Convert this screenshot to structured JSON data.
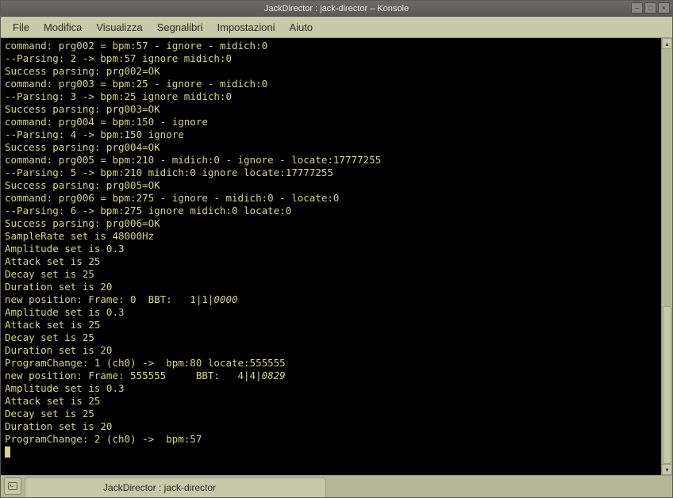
{
  "window": {
    "title": "JackDirector : jack-director – Konsole"
  },
  "menu": {
    "file": "File",
    "edit": "Modifica",
    "view": "Visualizza",
    "bookmarks": "Segnalibri",
    "settings": "Impostazioni",
    "help": "Aiuto"
  },
  "terminal": {
    "lines": [
      {
        "t": "command: prg002 = bpm:57 - ignore - midich:0"
      },
      {
        "t": "--Parsing: 2 -> bpm:57 ignore midich:0"
      },
      {
        "t": "Success parsing: prg002=OK"
      },
      {
        "t": "command: prg003 = bpm:25 - ignore - midich:0"
      },
      {
        "t": "--Parsing: 3 -> bpm:25 ignore midich:0"
      },
      {
        "t": "Success parsing: prg003=OK"
      },
      {
        "t": "command: prg004 = bpm:150 - ignore"
      },
      {
        "t": "--Parsing: 4 -> bpm:150 ignore"
      },
      {
        "t": "Success parsing: prg004=OK"
      },
      {
        "t": "command: prg005 = bpm:210 - midich:0 - ignore - locate:17777255"
      },
      {
        "t": "--Parsing: 5 -> bpm:210 midich:0 ignore locate:17777255"
      },
      {
        "t": "Success parsing: prg005=OK"
      },
      {
        "t": "command: prg006 = bpm:275 - ignore - midich:0 - locate:0"
      },
      {
        "t": "--Parsing: 6 -> bpm:275 ignore midich:0 locate:0"
      },
      {
        "t": "Success parsing: prg006=OK"
      },
      {
        "t": "SampleRate set is 48000Hz"
      },
      {
        "t": "Amplitude set is 0.3"
      },
      {
        "t": "Attack set is 25"
      },
      {
        "t": "Decay set is 25"
      },
      {
        "t": "Duration set is 20"
      },
      {
        "pre": "new position: Frame: 0  BBT:   1|1|",
        "it": "0000"
      },
      {
        "t": "Amplitude set is 0.3"
      },
      {
        "t": "Attack set is 25"
      },
      {
        "t": "Decay set is 25"
      },
      {
        "t": "Duration set is 20"
      },
      {
        "t": "ProgramChange: 1 (ch0) ->  bpm:80 locate:555555"
      },
      {
        "pre": "new position: Frame: 555555     BBT:   4|4|",
        "it": "0829"
      },
      {
        "t": "Amplitude set is 0.3"
      },
      {
        "t": "Attack set is 25"
      },
      {
        "t": "Decay set is 25"
      },
      {
        "t": "Duration set is 20"
      },
      {
        "t": "ProgramChange: 2 (ch0) ->  bpm:57"
      }
    ]
  },
  "scrollbar": {
    "thumb_top_pct": 62,
    "thumb_height_pct": 38
  },
  "tabs": {
    "active": "JackDirector : jack-director"
  },
  "glyphs": {
    "minimize": "–",
    "maximize": "□",
    "close": "×",
    "up": "▴",
    "down": "▾"
  }
}
